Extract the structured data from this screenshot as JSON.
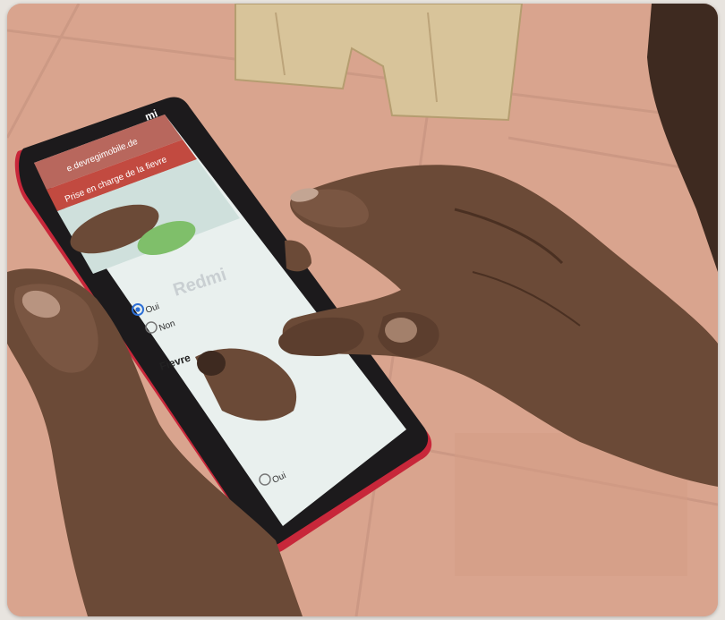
{
  "photo": {
    "scene": "hands-holding-smartphone",
    "colors": {
      "floor": "#d9a48e",
      "grout": "#c79580",
      "wood": "#d8c49a",
      "skin": "#6b4a37",
      "skin_dark": "#4a3022",
      "phone_body": "#1c1a1c",
      "phone_edge": "#c8273a",
      "screen": "#e9f0ee"
    }
  },
  "phone": {
    "brand": "Redmi",
    "brand_sub": "mi",
    "url": "e.devregimobile.de",
    "banner": "Prise en charge de la fievre",
    "options": {
      "first": "Oui",
      "second": "Non",
      "third": "Oui"
    },
    "section": "Fievre"
  }
}
